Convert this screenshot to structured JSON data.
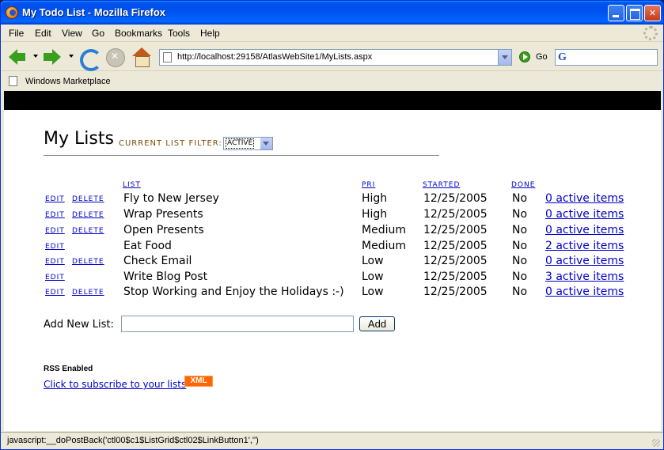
{
  "window": {
    "title": "My Todo List - Mozilla Firefox"
  },
  "menu": [
    "File",
    "Edit",
    "View",
    "Go",
    "Bookmarks",
    "Tools",
    "Help"
  ],
  "nav": {
    "url": "http://localhost:29158/AtlasWebSite1/MyLists.aspx",
    "go_label": "Go",
    "search_value": ""
  },
  "bookmarks": {
    "items": [
      "Windows Marketplace"
    ]
  },
  "page": {
    "title": "My Lists",
    "filter_label": "Current List Filter:",
    "filter_value": "ACTIVE",
    "columns": {
      "list": "LIST",
      "pri": "PRI",
      "started": "STARTED",
      "done": "DONE"
    },
    "edit_label": "EDIT",
    "delete_label": "DELETE",
    "rows": [
      {
        "name": "Fly to New Jersey",
        "pri": "High",
        "started": "12/25/2005",
        "done": "No",
        "items": "0 active items",
        "deletable": true
      },
      {
        "name": "Wrap Presents",
        "pri": "High",
        "started": "12/25/2005",
        "done": "No",
        "items": "0 active items",
        "deletable": true
      },
      {
        "name": "Open Presents",
        "pri": "Medium",
        "started": "12/25/2005",
        "done": "No",
        "items": "0 active items",
        "deletable": true
      },
      {
        "name": "Eat Food",
        "pri": "Medium",
        "started": "12/25/2005",
        "done": "No",
        "items": "2 active items",
        "deletable": false
      },
      {
        "name": "Check Email",
        "pri": "Low",
        "started": "12/25/2005",
        "done": "No",
        "items": "0 active items",
        "deletable": true
      },
      {
        "name": "Write Blog Post",
        "pri": "Low",
        "started": "12/25/2005",
        "done": "No",
        "items": "3 active items",
        "deletable": false
      },
      {
        "name": "Stop Working and Enjoy the Holidays :-)",
        "pri": "Low",
        "started": "12/25/2005",
        "done": "No",
        "items": "0 active items",
        "deletable": true
      }
    ],
    "add_label": "Add New List:",
    "add_value": "",
    "add_button": "Add",
    "rss_label": "RSS Enabled",
    "rss_link": "Click to subscribe to your lists",
    "xml_badge": "XML"
  },
  "status": {
    "text": "javascript:__doPostBack('ctl00$c1$ListGrid$ctl02$LinkButton1','')"
  },
  "colors": {
    "link": "#0000cc",
    "xp_titlebar": "#0053ee",
    "xml_badge": "#ff6600",
    "filter_label": "#7a4a00"
  },
  "icons": {
    "title": "firefox-icon",
    "back": "back-arrow-icon",
    "forward": "forward-arrow-icon",
    "reload": "reload-icon",
    "stop": "stop-icon",
    "home": "home-icon",
    "go": "go-icon",
    "search_engine": "google-icon"
  }
}
